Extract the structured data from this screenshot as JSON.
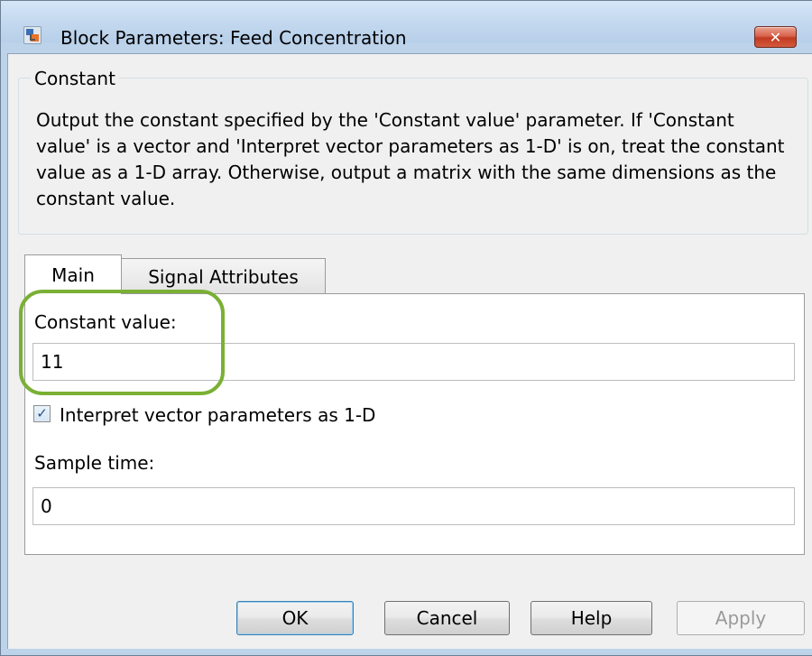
{
  "window": {
    "title": "Block Parameters: Feed Concentration",
    "close_glyph": "✕"
  },
  "group": {
    "legend": "Constant",
    "description": "Output the constant specified by the 'Constant value' parameter. If 'Constant value' is a vector and 'Interpret vector parameters as 1-D' is on, treat the constant value as a 1-D array. Otherwise, output a matrix with the same dimensions as the constant value."
  },
  "tabs": [
    {
      "label": "Main",
      "selected": true
    },
    {
      "label": "Signal Attributes",
      "selected": false
    }
  ],
  "main": {
    "constant_label": "Constant value:",
    "constant_value": "11",
    "interpret_label": "Interpret vector parameters as 1-D",
    "interpret_checked": true,
    "sample_time_label": "Sample time:",
    "sample_time_value": "0"
  },
  "buttons": {
    "ok": "OK",
    "cancel": "Cancel",
    "help": "Help",
    "apply": "Apply"
  },
  "colors": {
    "highlight": "#7ab034",
    "close_button": "#c23a22"
  },
  "icons": {
    "app": "block-parameters-icon",
    "close": "close-icon",
    "checkbox": "checkmark-icon"
  }
}
